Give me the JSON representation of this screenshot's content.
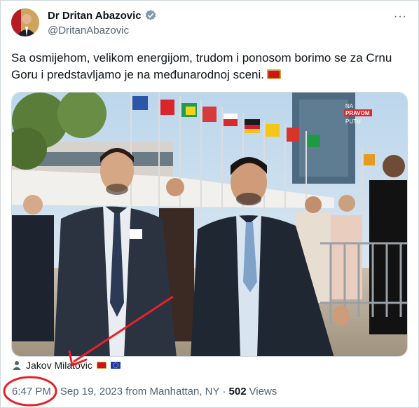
{
  "author": {
    "display_name": "Dr Dritan Abazovic",
    "handle": "@DritanAbazovic"
  },
  "more_label": "···",
  "tweet": {
    "text": "Sa osmijehom, velikom energijom, trudom i ponosom borimo se za Crnu Goru i predstavljamo je na međunarodnoj sceni."
  },
  "media": {
    "watermark_line1": "NA",
    "watermark_line2": "PRAVOM",
    "watermark_line3": "PUTU"
  },
  "tag": {
    "name": "Jakov Milatovic"
  },
  "meta": {
    "time": "6:47 PM",
    "separator1": "·",
    "date_location": "Sep 19, 2023 from Manhattan, NY",
    "separator2": "·",
    "views_count": "502",
    "views_label": "Views"
  },
  "colors": {
    "accent_red": "#e8202a",
    "secondary_text": "#536471",
    "verified": "#829aab"
  },
  "icons": [
    "verified-badge-icon",
    "more-options-icon",
    "person-tag-icon",
    "montenegro-flag-icon",
    "eu-flag-icon"
  ]
}
